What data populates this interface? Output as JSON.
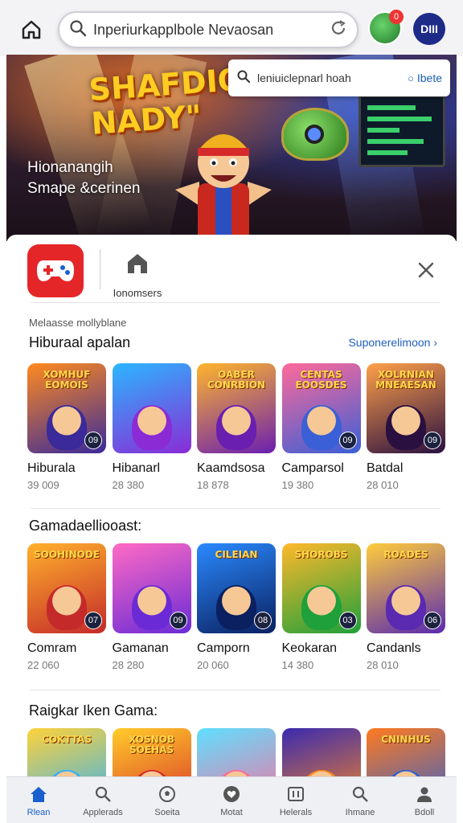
{
  "topbar": {
    "search_text": "Inperiurkapplbole Nevaosan",
    "avatar1_badge": "0",
    "avatar2_label": "DIII"
  },
  "hero": {
    "title": "SHAFDION NADY\"",
    "subtitle_line1": "Hionanangih",
    "subtitle_line2": "Smape &cerinen",
    "search_text": "leniuiclepnarl hoah",
    "search_button": "Ibete"
  },
  "app_header": {
    "category_label": "Ionomsers"
  },
  "caption": "Melaasse mollyblane",
  "sections": [
    {
      "title": "Hiburaal apalan",
      "see_all": "Suponerelimoon",
      "items": [
        {
          "thumb_title": "XOMHUF EOMOIS",
          "badge": "09",
          "name": "Hiburala",
          "meta": "39 009",
          "colors": [
            "#ff8a1f",
            "#3a2a9a"
          ]
        },
        {
          "thumb_title": "",
          "badge": "",
          "name": "Hibanarl",
          "meta": "28 380",
          "colors": [
            "#2bb6ff",
            "#8a2bd6"
          ]
        },
        {
          "thumb_title": "OABER CONRBION",
          "badge": "",
          "name": "Kaamdsosa",
          "meta": "18 878",
          "colors": [
            "#ffb52b",
            "#6a1fb0"
          ]
        },
        {
          "thumb_title": "CENTAS EOOSDES",
          "badge": "09",
          "name": "Camparsol",
          "meta": "19 380",
          "colors": [
            "#ff6a9a",
            "#3a5fd6"
          ]
        },
        {
          "thumb_title": "XOLRNIAN MNEAESAN",
          "badge": "09",
          "name": "Batdal",
          "meta": "28 010",
          "colors": [
            "#ffa04a",
            "#2a1040"
          ]
        }
      ]
    },
    {
      "title": "Gamadaelliooast:",
      "see_all": "",
      "items": [
        {
          "thumb_title": "SOOHINODE",
          "badge": "07",
          "name": "Comram",
          "meta": "22 060",
          "colors": [
            "#ffb12b",
            "#c42a2a"
          ]
        },
        {
          "thumb_title": "",
          "badge": "09",
          "name": "Gamanan",
          "meta": "28 280",
          "colors": [
            "#ff6ac4",
            "#6a2bd6"
          ]
        },
        {
          "thumb_title": "CILEIAN",
          "badge": "08",
          "name": "Camporn",
          "meta": "20 060",
          "colors": [
            "#2a8aff",
            "#0a2060"
          ]
        },
        {
          "thumb_title": "SHOROBS",
          "badge": "03",
          "name": "Keokaran",
          "meta": "14 380",
          "colors": [
            "#ffb82b",
            "#1fa03a"
          ]
        },
        {
          "thumb_title": "ROADES",
          "badge": "06",
          "name": "Candanls",
          "meta": "28 010",
          "colors": [
            "#ffcc3a",
            "#5a2ab0"
          ]
        }
      ]
    },
    {
      "title": "Raigkar Iken Gama:",
      "see_all": "",
      "items": [
        {
          "thumb_title": "COKTTAS",
          "badge": "",
          "name": "",
          "meta": "",
          "colors": [
            "#ffd23a",
            "#2ab0ff"
          ]
        },
        {
          "thumb_title": "XOSNOB SOEHAS",
          "badge": "",
          "name": "",
          "meta": "",
          "colors": [
            "#ffcc2a",
            "#d62a2a"
          ]
        },
        {
          "thumb_title": "",
          "badge": "",
          "name": "",
          "meta": "",
          "colors": [
            "#5fe0ff",
            "#ff6a9a"
          ]
        },
        {
          "thumb_title": "",
          "badge": "",
          "name": "",
          "meta": "",
          "colors": [
            "#3a2ab0",
            "#ff8a1f"
          ]
        },
        {
          "thumb_title": "CNINHUS",
          "badge": "",
          "name": "",
          "meta": "",
          "colors": [
            "#ff7a1f",
            "#2a5fd6"
          ]
        }
      ]
    }
  ],
  "bottom_nav": [
    {
      "label": "Rlean",
      "icon": "home-icon",
      "active": true
    },
    {
      "label": "Applerads",
      "icon": "search-icon",
      "active": false
    },
    {
      "label": "Soeita",
      "icon": "soccer-ball-icon",
      "active": false
    },
    {
      "label": "Motat",
      "icon": "heart-icon",
      "active": false
    },
    {
      "label": "Helerals",
      "icon": "grid-icon",
      "active": false
    },
    {
      "label": "Ihmane",
      "icon": "magnifier-icon",
      "active": false
    },
    {
      "label": "Bdoll",
      "icon": "profile-icon",
      "active": false
    }
  ],
  "accent_color": "#1a5fcf",
  "brand_red": "#e52629"
}
